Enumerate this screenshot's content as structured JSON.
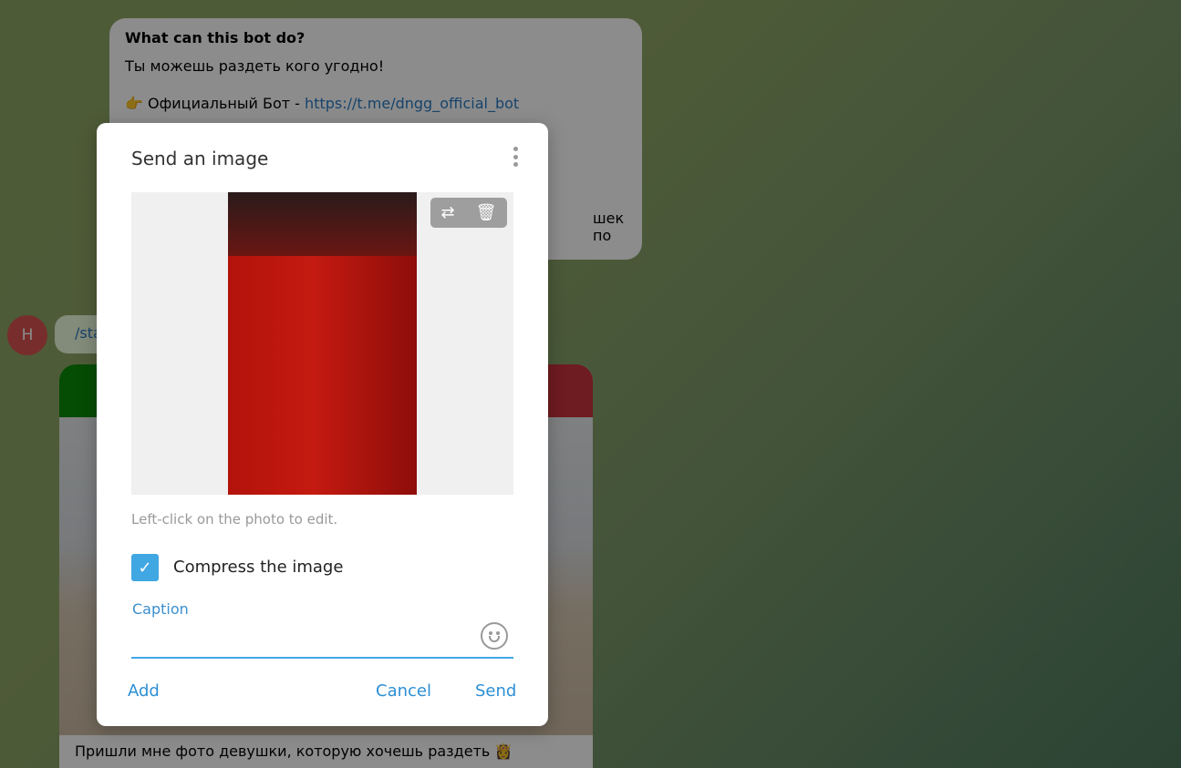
{
  "bot_info": {
    "title": "What can this bot do?",
    "line1": "Ты можешь раздеть кого угодно!",
    "official_prefix": "👉 Официальный Бот - ",
    "official_link": "https://t.me/dngg_official_bot",
    "partial_text": "шек по"
  },
  "chat": {
    "avatar_letter": "H",
    "command": "/sta",
    "photo_caption": "Пришли мне фото девушки, которую хочешь раздеть 👸"
  },
  "dialog": {
    "title": "Send an image",
    "hint": "Left-click on the photo to edit.",
    "compress_label": "Compress the image",
    "compress_checked": true,
    "caption_label": "Caption",
    "caption_value": "",
    "buttons": {
      "add": "Add",
      "cancel": "Cancel",
      "send": "Send"
    },
    "icons": [
      "more-vertical-icon",
      "replace-icon",
      "trash-icon",
      "emoji-icon",
      "checkmark-icon"
    ],
    "accent": "#40a7e3"
  }
}
